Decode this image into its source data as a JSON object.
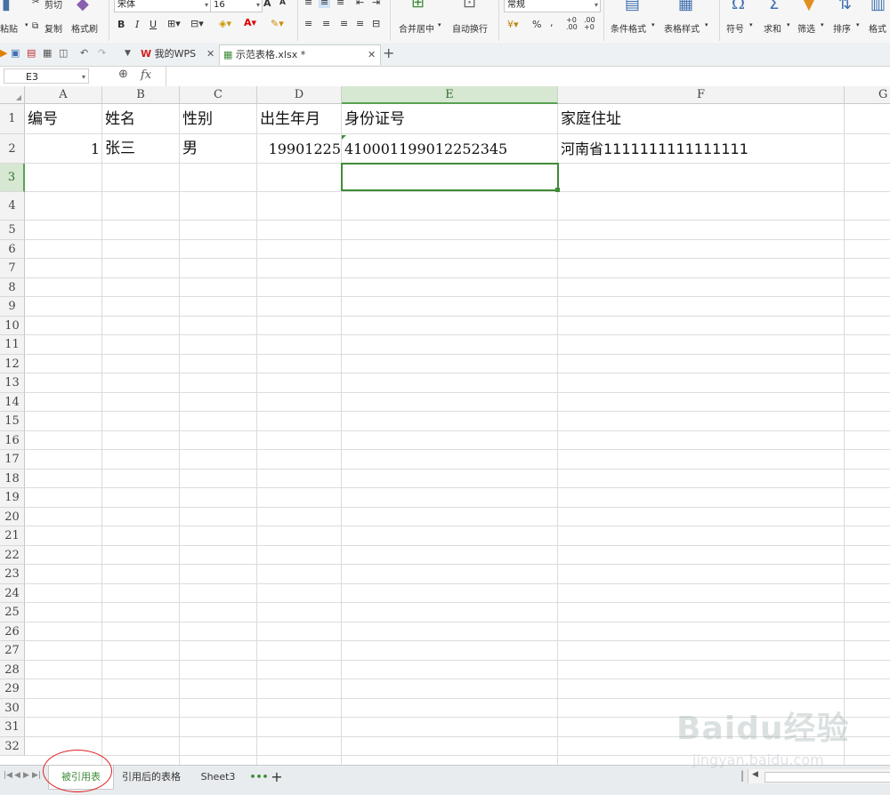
{
  "ribbon": {
    "cut": "剪切",
    "paste": "粘贴",
    "copy": "复制",
    "format_painter": "格式刷",
    "font_name": "宋体",
    "font_size": "16",
    "bold": "B",
    "italic": "I",
    "underline": "U",
    "merge_center": "合并居中",
    "wrap_text": "自动换行",
    "number_format": "常规",
    "percent": "%",
    "conditional_format": "条件格式",
    "table_style": "表格样式",
    "symbol": "符号",
    "sum": "求和",
    "filter": "筛选",
    "sort": "排序",
    "format": "格式"
  },
  "tabs": {
    "my_wps": "我的WPS",
    "file": "示范表格.xlsx *"
  },
  "formula_bar": {
    "name_box": "E3",
    "fx_label": "fx",
    "formula_value": ""
  },
  "columns": [
    "A",
    "B",
    "C",
    "D",
    "E",
    "F",
    "G"
  ],
  "rows": [
    "1",
    "2",
    "3",
    "4",
    "5",
    "6",
    "7",
    "8",
    "9",
    "10",
    "11",
    "12",
    "13",
    "14",
    "15",
    "16",
    "17",
    "18",
    "19",
    "20",
    "21",
    "22",
    "23",
    "24",
    "25",
    "26",
    "27",
    "28",
    "29",
    "30",
    "31",
    "32"
  ],
  "cells": {
    "A1": "编号",
    "B1": "姓名",
    "C1": "性别",
    "D1": "出生年月",
    "E1": "身份证号",
    "F1": "家庭住址",
    "A2": "1",
    "B2": "张三",
    "C2": "男",
    "D2": "19901225",
    "E2": "410001199012252345",
    "F2": "河南省1111111111111111"
  },
  "selected_cell": "E3",
  "sheets": {
    "active": "被引用表",
    "second": "引用后的表格",
    "third": "Sheet3",
    "more": "•••",
    "add": "+"
  },
  "watermark": {
    "brand": "Baidu经验",
    "url": "jingyan.baidu.com"
  },
  "colors": {
    "accent": "#3f8c38",
    "selected_header": "#d6e7d2",
    "annotation_circle": "#e02020"
  }
}
